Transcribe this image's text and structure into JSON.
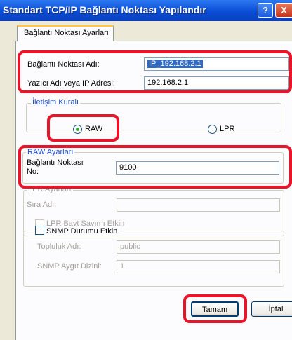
{
  "window": {
    "title": "Standart TCP/IP Bağlantı Noktası Yapılandır",
    "help_label": "?",
    "close_label": "X"
  },
  "tab": {
    "label": "Bağlantı Noktası Ayarları"
  },
  "port_name": {
    "label": "Bağlantı Noktası Adı:",
    "value": "IP_192.168.2.1"
  },
  "printer_address": {
    "label": "Yazıcı Adı veya IP Adresi:",
    "value": "192.168.2.1"
  },
  "protocol": {
    "legend": "İletişim Kuralı",
    "raw_label": "RAW",
    "lpr_label": "LPR",
    "selected": "RAW"
  },
  "raw_settings": {
    "legend": "RAW Ayarları",
    "port_number_label_1": "Bağlantı Noktası",
    "port_number_label_2": "No:",
    "port_number": "9100"
  },
  "lpr_settings": {
    "legend": "LPR Ayarları",
    "queue_name_label": "Sıra Adı:",
    "queue_name": "",
    "byte_count_label": "LPR Bayt Sayımı Etkin"
  },
  "snmp": {
    "label": "SNMP Durumu Etkin",
    "community_label": "Topluluk Adı:",
    "community_value": "public",
    "device_index_label": "SNMP Aygıt Dizini:",
    "device_index_value": "1"
  },
  "buttons": {
    "ok": "Tamam",
    "cancel": "İptal"
  },
  "colors": {
    "highlight": "#E8142A",
    "title_bar": "#0A4DD6",
    "group_title": "#1E4FD6"
  }
}
